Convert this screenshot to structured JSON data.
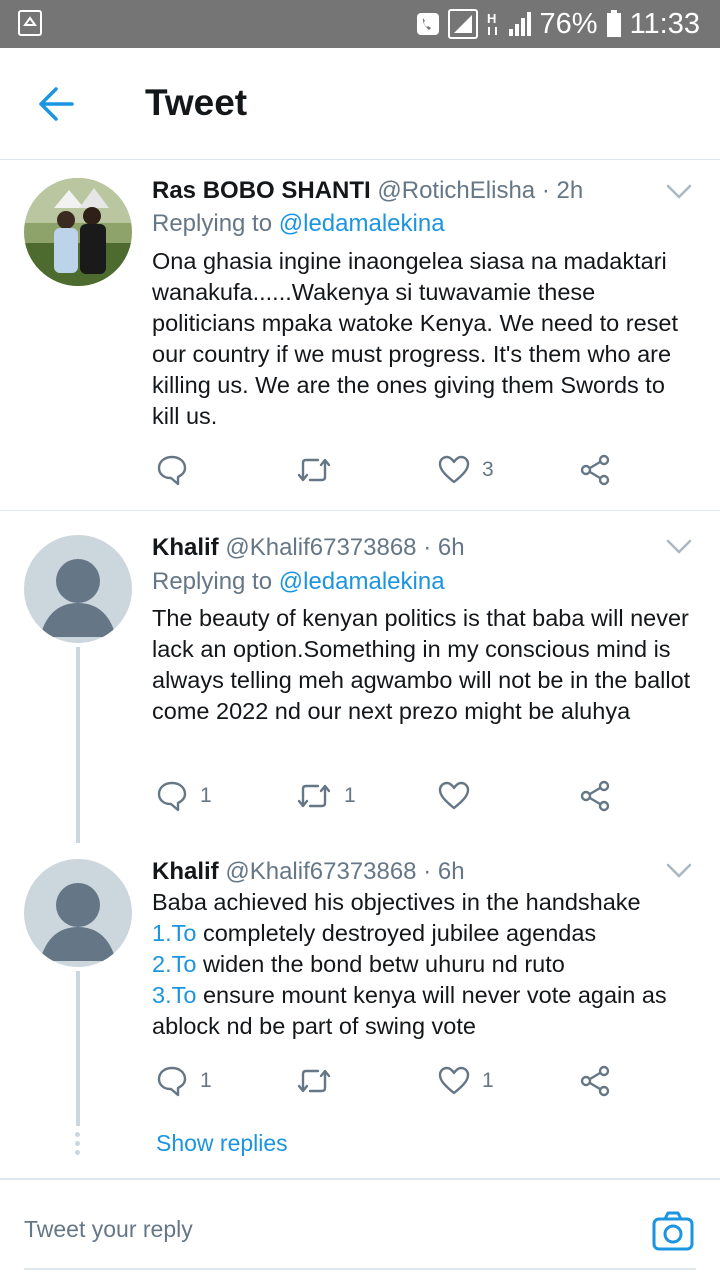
{
  "status_bar": {
    "battery": "76%",
    "time": "11:33"
  },
  "app_bar": {
    "title": "Tweet"
  },
  "tweets": [
    {
      "name": "Ras BOBO SHANTI",
      "handle": "@RotichElisha",
      "time": "· 2h",
      "replying_label": "Replying to",
      "replying_to": "@ledamalekina",
      "text": "Ona ghasia ingine inaongelea siasa na madaktari wanakufa......Wakenya si tuwavamie these politicians mpaka watoke Kenya. We need to reset our country if we must progress. It's them who are killing us. We are the ones giving them Swords to kill us.",
      "reply_count": "",
      "retweet_count": "",
      "like_count": "3"
    },
    {
      "name": "Khalif",
      "handle": "@Khalif67373868",
      "time": "· 6h",
      "replying_label": "Replying to",
      "replying_to": "@ledamalekina",
      "text": "The beauty of kenyan politics is that baba will never lack an option.Something in my conscious mind is always telling meh agwambo will not be in the ballot come 2022 nd our next prezo might be aluhya",
      "reply_count": "1",
      "retweet_count": "1",
      "like_count": ""
    },
    {
      "name": "Khalif",
      "handle": "@Khalif67373868",
      "time": "· 6h",
      "text_lines": [
        {
          "prefix": "",
          "rest": "Baba achieved his objectives in the handshake"
        },
        {
          "prefix": "1.To",
          "rest": " completely destroyed jubilee agendas"
        },
        {
          "prefix": "2.To",
          "rest": " widen the bond betw uhuru nd ruto"
        },
        {
          "prefix": "3.To",
          "rest": " ensure mount kenya will never vote again as"
        },
        {
          "prefix": "",
          "rest": "ablock nd be part of swing vote"
        }
      ],
      "reply_count": "1",
      "retweet_count": "",
      "like_count": "1"
    }
  ],
  "show_replies": "Show replies",
  "composer": {
    "placeholder": "Tweet your reply"
  },
  "colors": {
    "accent": "#1b95e0",
    "text": "#14171a",
    "muted": "#657786",
    "statusbar": "#757575"
  }
}
